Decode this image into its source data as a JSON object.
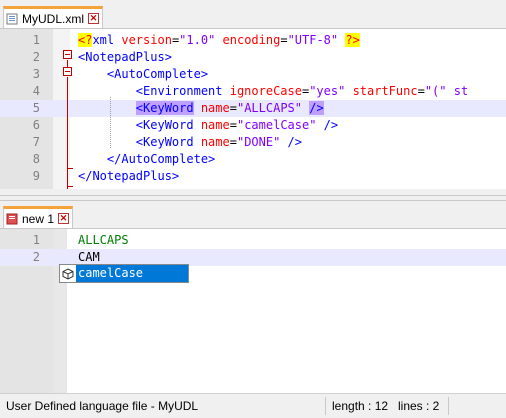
{
  "tabs": {
    "top": {
      "label": "MyUDL.xml",
      "close": "✕"
    },
    "bottom": {
      "label": "new 1",
      "close": "✕"
    }
  },
  "editor_top": {
    "line_numbers": [
      "1",
      "2",
      "3",
      "4",
      "5",
      "6",
      "7",
      "8",
      "9"
    ],
    "lines": [
      [
        {
          "t": "<?",
          "c": "c-pi"
        },
        {
          "t": "xml ",
          "c": "c-tag"
        },
        {
          "t": "version",
          "c": "c-attr"
        },
        {
          "t": "=",
          "c": "c-plain"
        },
        {
          "t": "\"1.0\"",
          "c": "c-val"
        },
        {
          "t": " ",
          "c": "c-plain"
        },
        {
          "t": "encoding",
          "c": "c-attr"
        },
        {
          "t": "=",
          "c": "c-plain"
        },
        {
          "t": "\"UTF-8\"",
          "c": "c-val"
        },
        {
          "t": " ",
          "c": "c-plain"
        },
        {
          "t": "?>",
          "c": "c-pi"
        }
      ],
      [
        {
          "t": "<NotepadPlus>",
          "c": "c-tag"
        }
      ],
      [
        {
          "t": "    <AutoComplete>",
          "c": "c-tag"
        }
      ],
      [
        {
          "t": "        <Environment ",
          "c": "c-tag"
        },
        {
          "t": "ignoreCase",
          "c": "c-attr"
        },
        {
          "t": "=",
          "c": "c-plain"
        },
        {
          "t": "\"yes\"",
          "c": "c-val"
        },
        {
          "t": " ",
          "c": "c-plain"
        },
        {
          "t": "startFunc",
          "c": "c-attr"
        },
        {
          "t": "=",
          "c": "c-plain"
        },
        {
          "t": "\"(\" st",
          "c": "c-val"
        }
      ],
      [
        {
          "t": "        ",
          "c": "c-plain"
        },
        {
          "t": "<KeyWord",
          "c": "c-tag c-hl"
        },
        {
          "t": " ",
          "c": "c-plain"
        },
        {
          "t": "name",
          "c": "c-attr"
        },
        {
          "t": "=",
          "c": "c-plain"
        },
        {
          "t": "\"ALLCAPS\"",
          "c": "c-val"
        },
        {
          "t": " ",
          "c": "c-plain"
        },
        {
          "t": "/>",
          "c": "c-tag c-hl"
        }
      ],
      [
        {
          "t": "        <KeyWord ",
          "c": "c-tag"
        },
        {
          "t": "name",
          "c": "c-attr"
        },
        {
          "t": "=",
          "c": "c-plain"
        },
        {
          "t": "\"camelCase\"",
          "c": "c-val"
        },
        {
          "t": " />",
          "c": "c-tag"
        }
      ],
      [
        {
          "t": "        <KeyWord ",
          "c": "c-tag"
        },
        {
          "t": "name",
          "c": "c-attr"
        },
        {
          "t": "=",
          "c": "c-plain"
        },
        {
          "t": "\"DONE\"",
          "c": "c-val"
        },
        {
          "t": " />",
          "c": "c-tag"
        }
      ],
      [
        {
          "t": "    </AutoComplete>",
          "c": "c-tag"
        }
      ],
      [
        {
          "t": "</NotepadPlus>",
          "c": "c-tag"
        }
      ]
    ]
  },
  "editor_bottom": {
    "line_numbers": [
      "1",
      "2"
    ],
    "lines": [
      [
        {
          "t": "ALLCAPS",
          "c": "c-green"
        }
      ],
      [
        {
          "t": "CAM",
          "c": "c-plain"
        }
      ]
    ]
  },
  "autocomplete": {
    "items": [
      "camelCase"
    ],
    "selected_color": "#0078d7"
  },
  "statusbar": {
    "language": "User Defined language file - MyUDL",
    "length": "length : 12",
    "lines": "lines : 2"
  },
  "colors": {
    "tag": "#0000ff",
    "attribute": "#ff0000",
    "value": "#8000ff",
    "active_tab_accent": "#f3a33a",
    "fold_marker": "#c00000"
  },
  "icons": {
    "tab_top": "xml-file-icon",
    "tab_bottom": "unsaved-file-icon",
    "autocomplete_item": "keyword-cube-icon"
  }
}
